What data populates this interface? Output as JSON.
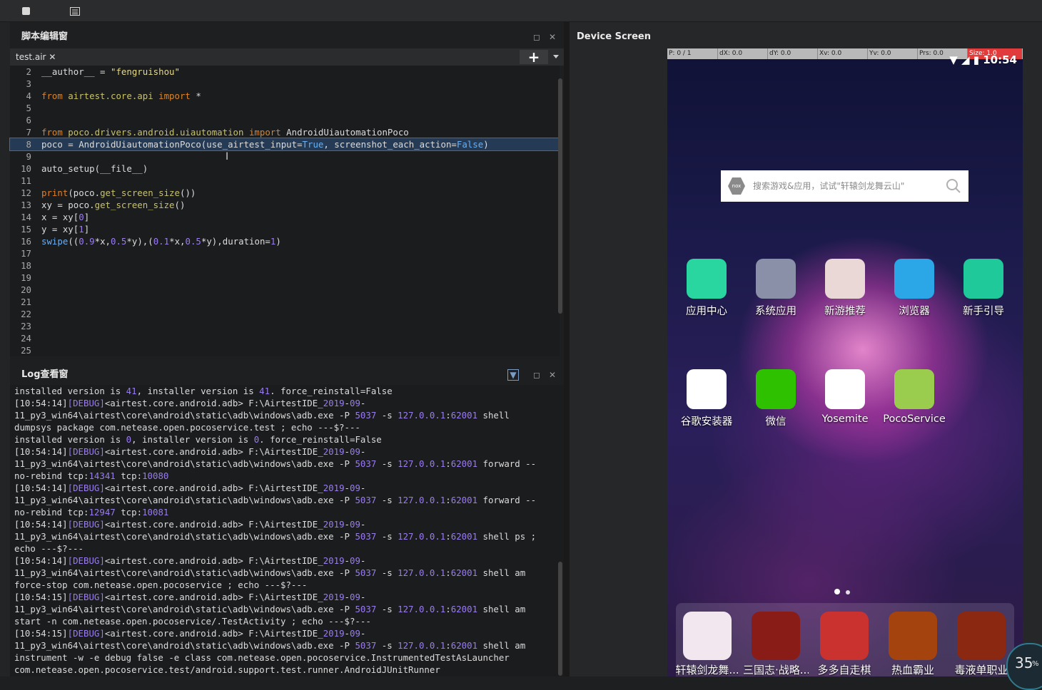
{
  "toolbar": {
    "stop_icon": "stop-icon",
    "list_icon": "list-icon"
  },
  "editor": {
    "title": "脚本编辑窗",
    "tab": "test.air",
    "tab_close": "✕",
    "add": "+",
    "lines": [
      {
        "n": "2"
      },
      {
        "n": "3"
      },
      {
        "n": "4"
      },
      {
        "n": "5"
      },
      {
        "n": "6"
      },
      {
        "n": "7"
      },
      {
        "n": "8"
      },
      {
        "n": "9"
      },
      {
        "n": "10"
      },
      {
        "n": "11"
      },
      {
        "n": "12"
      },
      {
        "n": "13"
      },
      {
        "n": "14"
      },
      {
        "n": "15"
      },
      {
        "n": "16"
      },
      {
        "n": "17"
      },
      {
        "n": "18"
      },
      {
        "n": "19"
      },
      {
        "n": "20"
      },
      {
        "n": "21"
      },
      {
        "n": "22"
      },
      {
        "n": "23"
      },
      {
        "n": "24"
      },
      {
        "n": "25"
      }
    ],
    "code": {
      "l2a": "__author__ = ",
      "l2b": "\"fengruishou\"",
      "l4a": "from",
      "l4b": " airtest.core.api ",
      "l4c": "import",
      "l4d": " *",
      "l7a": "from",
      "l7b": " poco.drivers.android.uiautomation ",
      "l7c": "import",
      "l7d": " AndroidUiautomationPoco",
      "l8a": "poco = AndroidUiautomationPoco(use_airtest_input=",
      "l8b": "True",
      "l8c": ", screenshot_each_action=",
      "l8d": "False",
      "l8e": ")",
      "l10": "auto_setup(__file__)",
      "l12a": "print",
      "l12b": "(poco.",
      "l12c": "get_screen_size",
      "l12d": "())",
      "l13a": "xy = poco.",
      "l13b": "get_screen_size",
      "l13c": "()",
      "l14a": "x = xy[",
      "l14b": "0",
      "l14c": "]",
      "l15a": "y = xy[",
      "l15b": "1",
      "l15c": "]",
      "l16a": "swipe",
      "l16b": "((",
      "l16c": "0.9",
      "l16d": "*x,",
      "l16e": "0.5",
      "l16f": "*y),(",
      "l16g": "0.1",
      "l16h": "*x,",
      "l16i": "0.5",
      "l16j": "*y),duration=",
      "l16k": "1",
      "l16l": ")"
    }
  },
  "log": {
    "title": "Log查看窗",
    "lines": [
      [
        "installed version is ",
        "41",
        ", installer version is ",
        "41",
        ". force_reinstall=False"
      ],
      [
        "[10:54:14]",
        "[DEBUG]",
        "<airtest.core.android.adb> F:\\AirtestIDE_",
        "2019",
        "-",
        "09",
        "-"
      ],
      [
        "11_py3_win64\\airtest\\core\\android\\static\\adb\\windows\\adb.exe -P ",
        "5037",
        " -s ",
        "127.0.0.1",
        ":",
        "62001",
        " shell"
      ],
      [
        "dumpsys package com.netease.open.pocoservice.test ; echo ---$?---"
      ],
      [
        "installed version is ",
        "0",
        ", installer version is ",
        "0",
        ". force_reinstall=False"
      ],
      [
        "[10:54:14]",
        "[DEBUG]",
        "<airtest.core.android.adb> F:\\AirtestIDE_",
        "2019",
        "-",
        "09",
        "-"
      ],
      [
        "11_py3_win64\\airtest\\core\\android\\static\\adb\\windows\\adb.exe -P ",
        "5037",
        " -s ",
        "127.0.0.1",
        ":",
        "62001",
        " forward --"
      ],
      [
        "no-rebind tcp:",
        "14341",
        " tcp:",
        "10080"
      ],
      [
        "[10:54:14]",
        "[DEBUG]",
        "<airtest.core.android.adb> F:\\AirtestIDE_",
        "2019",
        "-",
        "09",
        "-"
      ],
      [
        "11_py3_win64\\airtest\\core\\android\\static\\adb\\windows\\adb.exe -P ",
        "5037",
        " -s ",
        "127.0.0.1",
        ":",
        "62001",
        " forward --"
      ],
      [
        "no-rebind tcp:",
        "12947",
        " tcp:",
        "10081"
      ],
      [
        "[10:54:14]",
        "[DEBUG]",
        "<airtest.core.android.adb> F:\\AirtestIDE_",
        "2019",
        "-",
        "09",
        "-"
      ],
      [
        "11_py3_win64\\airtest\\core\\android\\static\\adb\\windows\\adb.exe -P ",
        "5037",
        " -s ",
        "127.0.0.1",
        ":",
        "62001",
        " shell ps ;"
      ],
      [
        "echo ---$?---"
      ],
      [
        "[10:54:14]",
        "[DEBUG]",
        "<airtest.core.android.adb> F:\\AirtestIDE_",
        "2019",
        "-",
        "09",
        "-"
      ],
      [
        "11_py3_win64\\airtest\\core\\android\\static\\adb\\windows\\adb.exe -P ",
        "5037",
        " -s ",
        "127.0.0.1",
        ":",
        "62001",
        " shell am"
      ],
      [
        "force-stop com.netease.open.pocoservice ; echo ---$?---"
      ],
      [
        "[10:54:15]",
        "[DEBUG]",
        "<airtest.core.android.adb> F:\\AirtestIDE_",
        "2019",
        "-",
        "09",
        "-"
      ],
      [
        "11_py3_win64\\airtest\\core\\android\\static\\adb\\windows\\adb.exe -P ",
        "5037",
        " -s ",
        "127.0.0.1",
        ":",
        "62001",
        " shell am"
      ],
      [
        "start -n com.netease.open.pocoservice/.TestActivity ; echo ---$?---"
      ],
      [
        "[10:54:15]",
        "[DEBUG]",
        "<airtest.core.android.adb> F:\\AirtestIDE_",
        "2019",
        "-",
        "09",
        "-"
      ],
      [
        "11_py3_win64\\airtest\\core\\android\\static\\adb\\windows\\adb.exe -P ",
        "5037",
        " -s ",
        "127.0.0.1",
        ":",
        "62001",
        " shell am"
      ],
      [
        "instrument -w -e debug false -e class com.netease.open.pocoservice.InstrumentedTestAsLauncher"
      ],
      [
        "com.netease.open.pocoservice.test/android.support.test.runner.AndroidJUnitRunner"
      ]
    ]
  },
  "device": {
    "title": "Device Screen",
    "pointer": [
      "P: 0 / 1",
      "dX: 0.0",
      "dY: 0.0",
      "Xv: 0.0",
      "Yv: 0.0",
      "Prs: 0.0",
      "Size: 1.0"
    ],
    "time": "10:54",
    "search_placeholder": "搜索游戏&应用，试试\"轩辕剑龙舞云山\"",
    "search_logo": "nox",
    "row1": [
      {
        "label": "应用中心",
        "icon": "app-center-icon",
        "color": "#2ad6a0"
      },
      {
        "label": "系统应用",
        "icon": "system-apps-folder-icon",
        "color": "#8a90a8"
      },
      {
        "label": "新游推荐",
        "icon": "new-games-icon",
        "color": "#e9d8d6"
      },
      {
        "label": "浏览器",
        "icon": "browser-icon",
        "color": "#2ba6e6"
      },
      {
        "label": "新手引导",
        "icon": "guide-icon",
        "color": "#1fc99a"
      }
    ],
    "row2": [
      {
        "label": "谷歌安装器",
        "icon": "google-installer-icon",
        "color": "#ffffff"
      },
      {
        "label": "微信",
        "icon": "wechat-icon",
        "color": "#2dc100"
      },
      {
        "label": "Yosemite",
        "icon": "yosemite-icon",
        "color": "#ffffff"
      },
      {
        "label": "PocoService",
        "icon": "android-icon",
        "color": "#9acd4e"
      }
    ],
    "dock": [
      {
        "label": "轩辕剑龙舞...",
        "icon": "xuanyuan-game-icon",
        "color": "#f2e7ee"
      },
      {
        "label": "三国志·战略...",
        "icon": "sanguo-game-icon",
        "color": "#8a1c18"
      },
      {
        "label": "多多自走棋",
        "icon": "autochess-game-icon",
        "color": "#c9322f"
      },
      {
        "label": "热血霸业",
        "icon": "rexue-game-icon",
        "color": "#a5430f"
      },
      {
        "label": "毒液单职业",
        "icon": "duye-game-icon",
        "color": "#8a2812"
      }
    ],
    "percent": "35",
    "percent_unit": "%"
  }
}
